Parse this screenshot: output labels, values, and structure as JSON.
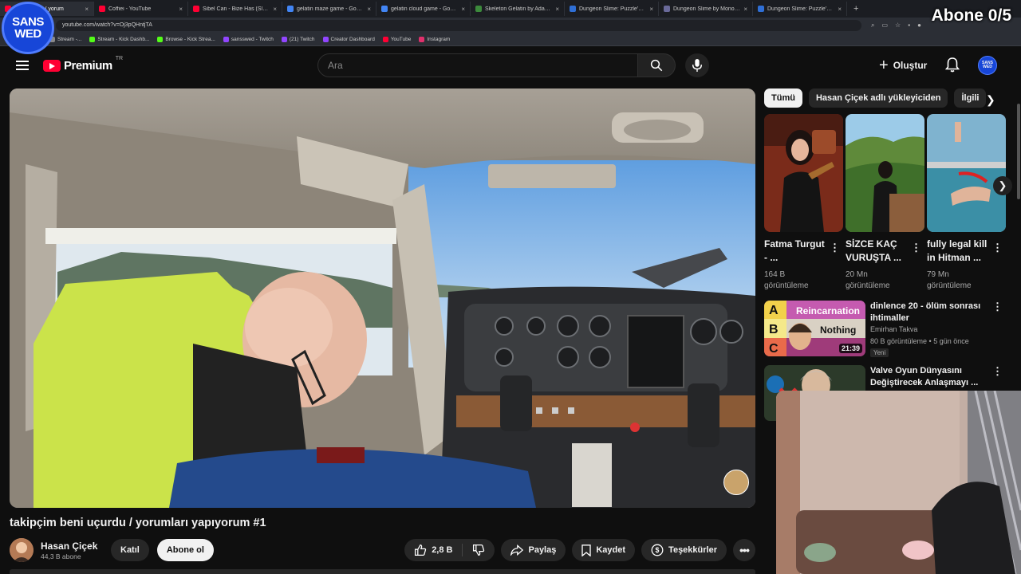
{
  "browser": {
    "tabs": [
      {
        "title": "beni uçurdu / yorum",
        "active": true,
        "fav": "#ff0033"
      },
      {
        "title": "Coffiei - YouTube",
        "fav": "#ff0033"
      },
      {
        "title": "Sibel Can - Bize Has (Slowed -",
        "fav": "#ff0033"
      },
      {
        "title": "gelatin maze game - Google'd",
        "fav": "#4285f4"
      },
      {
        "title": "gelatin cloud game - Google'd",
        "fav": "#4285f4"
      },
      {
        "title": "Skeleton Gelatin by Adam Salt",
        "fav": "#3c8a3c"
      },
      {
        "title": "Dungeon Slime: Puzzle's Adver",
        "fav": "#2f6fd6"
      },
      {
        "title": "Dungeon Slime by MonoGame",
        "fav": "#6a6a9a"
      },
      {
        "title": "Dungeon Slime: Puzzle's Adver",
        "fav": "#2f6fd6"
      }
    ],
    "tab_close": "×",
    "new_tab": "+",
    "url": "youtube.com/watch?v=Oj3pQHntjTA",
    "bookmarks": [
      {
        "label": "Stream -...",
        "fav": "#888"
      },
      {
        "label": "Stream - Kick Dashb...",
        "fav": "#53fc18"
      },
      {
        "label": "Browse - Kick Strea...",
        "fav": "#53fc18"
      },
      {
        "label": "sansswed - Twitch",
        "fav": "#9146ff"
      },
      {
        "label": "(21) Twitch",
        "fav": "#9146ff"
      },
      {
        "label": "Creator Dashboard",
        "fav": "#9146ff"
      },
      {
        "label": "YouTube",
        "fav": "#ff0033"
      },
      {
        "label": "Instagram",
        "fav": "#e1306c"
      }
    ]
  },
  "overlay": {
    "logo_line1": "SANS",
    "logo_line2": "WED",
    "sub_goal": "Abone 0/5"
  },
  "header": {
    "logo_text": "Premium",
    "country": "TR",
    "search_placeholder": "Ara",
    "create_label": "Oluştur",
    "avatar_line1": "SANS",
    "avatar_line2": "WED"
  },
  "video": {
    "title": "takipçim beni uçurdu / yorumları yapıyorum #1",
    "channel": "Hasan Çiçek",
    "subscribers": "44,3 B abone",
    "join_label": "Katıl",
    "subscribe_label": "Abone ol",
    "likes": "2,8 B",
    "share_label": "Paylaş",
    "save_label": "Kaydet",
    "thanks_label": "Teşekkürler"
  },
  "sidebar": {
    "chips": [
      {
        "label": "Tümü",
        "active": true
      },
      {
        "label": "Hasan Çiçek adlı yükleyiciden"
      },
      {
        "label": "İlgili"
      }
    ],
    "shorts": [
      {
        "title": "Fatma Turgut - ...",
        "views": "164 B görüntüleme"
      },
      {
        "title": "SİZCE KAÇ VURUŞTA ...",
        "views": "20 Mn görüntüleme"
      },
      {
        "title": "fully legal kill in Hitman ...",
        "views": "79 Mn görüntüleme"
      }
    ],
    "recs": [
      {
        "title": "dinlence 20 - ölüm sonrası ihtimaller",
        "channel": "Emirhan Takva",
        "meta": "80 B görüntüleme • 5 gün önce",
        "badge": "Yeni",
        "duration": "21:39",
        "thumb_text": "Reincarnation",
        "thumb_text2": "Nothing",
        "thumb_letters": [
          "A",
          "B",
          "C"
        ]
      },
      {
        "title": "Valve Oyun Dünyasını Değiştirecek Anlaşmayı ...",
        "channel": "",
        "meta": "",
        "badge": "",
        "duration": ""
      }
    ]
  }
}
